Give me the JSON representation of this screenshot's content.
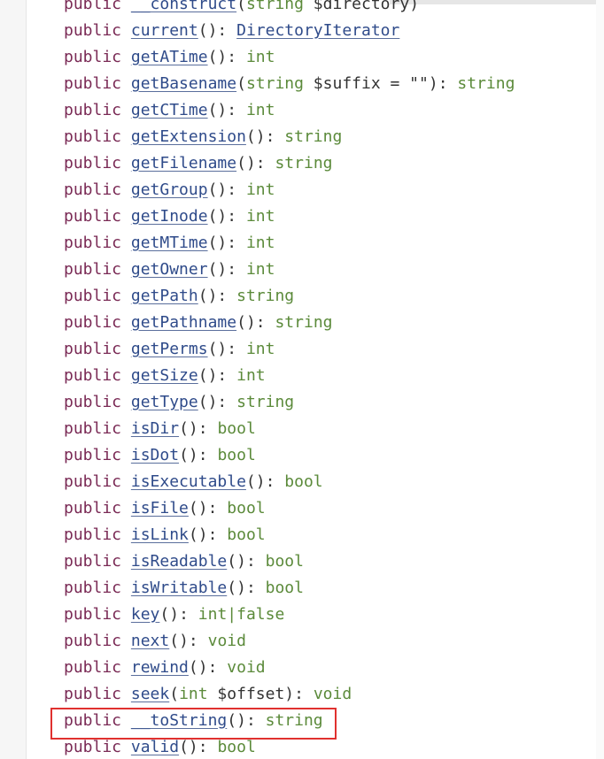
{
  "keyword": "public",
  "methods": [
    {
      "name": "__construct",
      "open": "(",
      "param_type": "string",
      "param_name": " $directory",
      "param_default": "",
      "close": ")",
      "sep": "",
      "ret": "",
      "ret_is_link": false
    },
    {
      "name": "current",
      "open": "(",
      "param_type": "",
      "param_name": "",
      "param_default": "",
      "close": ")",
      "sep": ": ",
      "ret": "DirectoryIterator",
      "ret_is_link": true
    },
    {
      "name": "getATime",
      "open": "(",
      "param_type": "",
      "param_name": "",
      "param_default": "",
      "close": ")",
      "sep": ": ",
      "ret": "int",
      "ret_is_link": false
    },
    {
      "name": "getBasename",
      "open": "(",
      "param_type": "string",
      "param_name": " $suffix",
      "param_default": " = \"\"",
      "close": ")",
      "sep": ": ",
      "ret": "string",
      "ret_is_link": false
    },
    {
      "name": "getCTime",
      "open": "(",
      "param_type": "",
      "param_name": "",
      "param_default": "",
      "close": ")",
      "sep": ": ",
      "ret": "int",
      "ret_is_link": false
    },
    {
      "name": "getExtension",
      "open": "(",
      "param_type": "",
      "param_name": "",
      "param_default": "",
      "close": ")",
      "sep": ": ",
      "ret": "string",
      "ret_is_link": false
    },
    {
      "name": "getFilename",
      "open": "(",
      "param_type": "",
      "param_name": "",
      "param_default": "",
      "close": ")",
      "sep": ": ",
      "ret": "string",
      "ret_is_link": false
    },
    {
      "name": "getGroup",
      "open": "(",
      "param_type": "",
      "param_name": "",
      "param_default": "",
      "close": ")",
      "sep": ": ",
      "ret": "int",
      "ret_is_link": false
    },
    {
      "name": "getInode",
      "open": "(",
      "param_type": "",
      "param_name": "",
      "param_default": "",
      "close": ")",
      "sep": ": ",
      "ret": "int",
      "ret_is_link": false
    },
    {
      "name": "getMTime",
      "open": "(",
      "param_type": "",
      "param_name": "",
      "param_default": "",
      "close": ")",
      "sep": ": ",
      "ret": "int",
      "ret_is_link": false
    },
    {
      "name": "getOwner",
      "open": "(",
      "param_type": "",
      "param_name": "",
      "param_default": "",
      "close": ")",
      "sep": ": ",
      "ret": "int",
      "ret_is_link": false
    },
    {
      "name": "getPath",
      "open": "(",
      "param_type": "",
      "param_name": "",
      "param_default": "",
      "close": ")",
      "sep": ": ",
      "ret": "string",
      "ret_is_link": false
    },
    {
      "name": "getPathname",
      "open": "(",
      "param_type": "",
      "param_name": "",
      "param_default": "",
      "close": ")",
      "sep": ": ",
      "ret": "string",
      "ret_is_link": false
    },
    {
      "name": "getPerms",
      "open": "(",
      "param_type": "",
      "param_name": "",
      "param_default": "",
      "close": ")",
      "sep": ": ",
      "ret": "int",
      "ret_is_link": false
    },
    {
      "name": "getSize",
      "open": "(",
      "param_type": "",
      "param_name": "",
      "param_default": "",
      "close": ")",
      "sep": ": ",
      "ret": "int",
      "ret_is_link": false
    },
    {
      "name": "getType",
      "open": "(",
      "param_type": "",
      "param_name": "",
      "param_default": "",
      "close": ")",
      "sep": ": ",
      "ret": "string",
      "ret_is_link": false
    },
    {
      "name": "isDir",
      "open": "(",
      "param_type": "",
      "param_name": "",
      "param_default": "",
      "close": ")",
      "sep": ": ",
      "ret": "bool",
      "ret_is_link": false
    },
    {
      "name": "isDot",
      "open": "(",
      "param_type": "",
      "param_name": "",
      "param_default": "",
      "close": ")",
      "sep": ": ",
      "ret": "bool",
      "ret_is_link": false
    },
    {
      "name": "isExecutable",
      "open": "(",
      "param_type": "",
      "param_name": "",
      "param_default": "",
      "close": ")",
      "sep": ": ",
      "ret": "bool",
      "ret_is_link": false
    },
    {
      "name": "isFile",
      "open": "(",
      "param_type": "",
      "param_name": "",
      "param_default": "",
      "close": ")",
      "sep": ": ",
      "ret": "bool",
      "ret_is_link": false
    },
    {
      "name": "isLink",
      "open": "(",
      "param_type": "",
      "param_name": "",
      "param_default": "",
      "close": ")",
      "sep": ": ",
      "ret": "bool",
      "ret_is_link": false
    },
    {
      "name": "isReadable",
      "open": "(",
      "param_type": "",
      "param_name": "",
      "param_default": "",
      "close": ")",
      "sep": ": ",
      "ret": "bool",
      "ret_is_link": false
    },
    {
      "name": "isWritable",
      "open": "(",
      "param_type": "",
      "param_name": "",
      "param_default": "",
      "close": ")",
      "sep": ": ",
      "ret": "bool",
      "ret_is_link": false
    },
    {
      "name": "key",
      "open": "(",
      "param_type": "",
      "param_name": "",
      "param_default": "",
      "close": ")",
      "sep": ": ",
      "ret": "int|false",
      "ret_is_link": false
    },
    {
      "name": "next",
      "open": "(",
      "param_type": "",
      "param_name": "",
      "param_default": "",
      "close": ")",
      "sep": ": ",
      "ret": "void",
      "ret_is_link": false
    },
    {
      "name": "rewind",
      "open": "(",
      "param_type": "",
      "param_name": "",
      "param_default": "",
      "close": ")",
      "sep": ": ",
      "ret": "void",
      "ret_is_link": false
    },
    {
      "name": "seek",
      "open": "(",
      "param_type": "int",
      "param_name": " $offset",
      "param_default": "",
      "close": ")",
      "sep": ": ",
      "ret": "void",
      "ret_is_link": false
    },
    {
      "name": "__toString",
      "open": "(",
      "param_type": "",
      "param_name": "",
      "param_default": "",
      "close": ")",
      "sep": ": ",
      "ret": "string",
      "ret_is_link": false,
      "highlighted": true
    },
    {
      "name": "valid",
      "open": "(",
      "param_type": "",
      "param_name": "",
      "param_default": "",
      "close": ")",
      "sep": ": ",
      "ret": "bool",
      "ret_is_link": false
    }
  ],
  "colors": {
    "keyword": "#7a2a55",
    "method_link": "#2f4b8a",
    "type": "#5b8a3a",
    "highlight": "#e0312f"
  }
}
